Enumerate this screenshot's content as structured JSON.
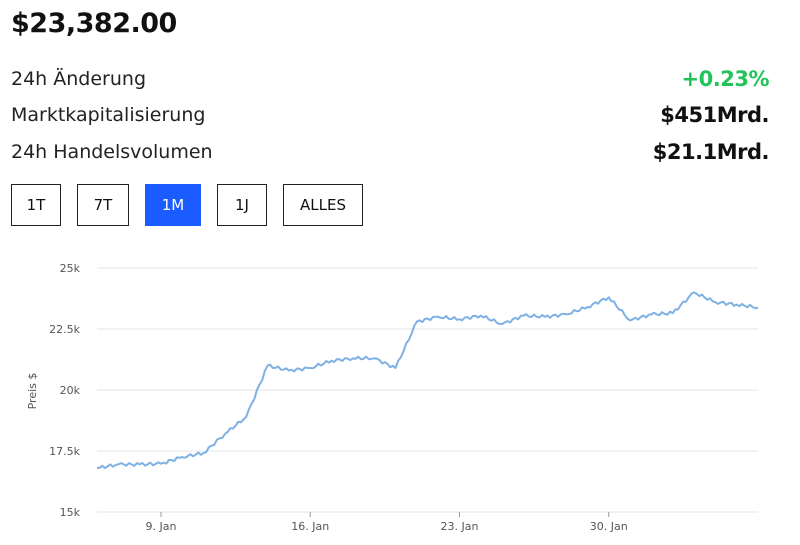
{
  "header": {
    "price": "$23,382.00"
  },
  "stats": [
    {
      "label": "24h Änderung",
      "value": "+0.23%",
      "positive": true
    },
    {
      "label": "Marktkapitalisierung",
      "value": "$451Mrd.",
      "positive": false
    },
    {
      "label": "24h Handelsvolumen",
      "value": "$21.1Mrd.",
      "positive": false
    }
  ],
  "ranges": [
    {
      "label": "1T",
      "active": false
    },
    {
      "label": "7T",
      "active": false
    },
    {
      "label": "1M",
      "active": true
    },
    {
      "label": "1J",
      "active": false
    },
    {
      "label": "ALLES",
      "active": false
    }
  ],
  "colors": {
    "line": "#7fb1e3",
    "active": "#1a5cff",
    "positive": "#21c35b"
  },
  "chart_data": {
    "type": "line",
    "ylabel": "Preis $",
    "xlabel": "",
    "ylim": [
      15000,
      25000
    ],
    "yticks": [
      15000,
      17500,
      20000,
      22500,
      25000
    ],
    "ytick_labels": [
      "15k",
      "17.5k",
      "20k",
      "22.5k",
      "25k"
    ],
    "xlim": [
      "2023-01-06",
      "2023-02-06"
    ],
    "xticks": [
      "2023-01-09",
      "2023-01-16",
      "2023-01-23",
      "2023-01-30"
    ],
    "xtick_labels": [
      "9. Jan",
      "16. Jan",
      "23. Jan",
      "30. Jan"
    ],
    "grid": true,
    "x": [
      "2023-01-06",
      "2023-01-07",
      "2023-01-08",
      "2023-01-09",
      "2023-01-10",
      "2023-01-11",
      "2023-01-12",
      "2023-01-13",
      "2023-01-14",
      "2023-01-15",
      "2023-01-16",
      "2023-01-17",
      "2023-01-18",
      "2023-01-19",
      "2023-01-20",
      "2023-01-21",
      "2023-01-22",
      "2023-01-23",
      "2023-01-24",
      "2023-01-25",
      "2023-01-26",
      "2023-01-27",
      "2023-01-28",
      "2023-01-29",
      "2023-01-30",
      "2023-01-31",
      "2023-02-01",
      "2023-02-02",
      "2023-02-03",
      "2023-02-04",
      "2023-02-05",
      "2023-02-06"
    ],
    "values": [
      16800,
      16950,
      16950,
      16980,
      17250,
      17420,
      18200,
      18900,
      21000,
      20800,
      20900,
      21200,
      21300,
      21300,
      20900,
      22800,
      23000,
      22900,
      23050,
      22700,
      23050,
      23000,
      23100,
      23400,
      23800,
      22850,
      23100,
      23150,
      24000,
      23600,
      23500,
      23382
    ]
  }
}
